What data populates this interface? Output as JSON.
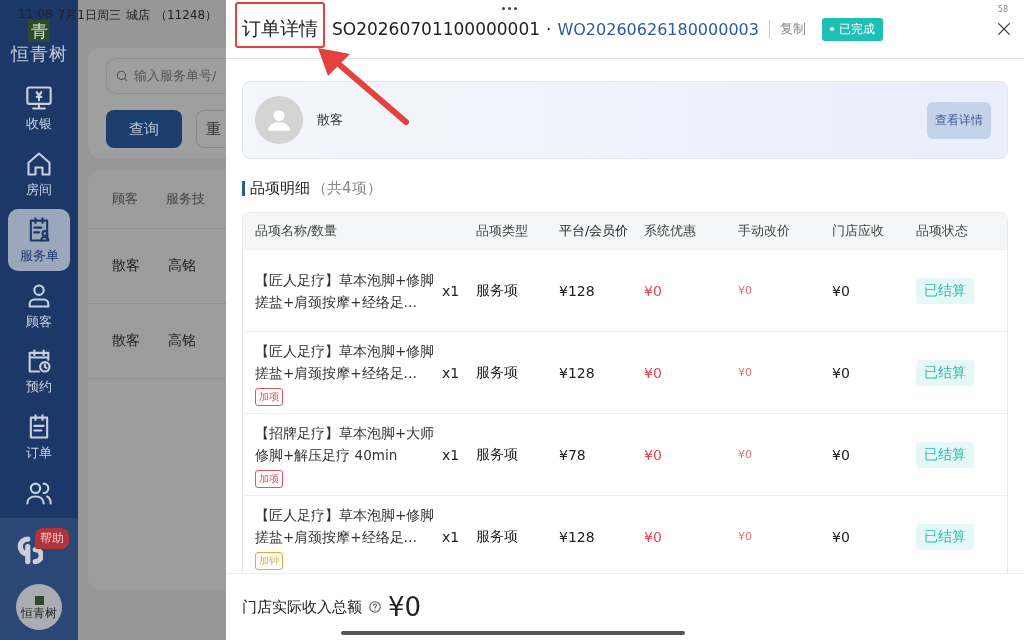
{
  "status_bar": {
    "time": "11:08",
    "date": "7月1日周三",
    "store": "城店",
    "store_code": "（11248）"
  },
  "sidebar": {
    "logo_char": "青",
    "brand": "恒青树",
    "items": [
      {
        "label": "收银",
        "selected": false
      },
      {
        "label": "房间",
        "selected": false
      },
      {
        "label": "服务单",
        "selected": true
      },
      {
        "label": "顾客",
        "selected": false
      },
      {
        "label": "预约",
        "selected": false
      },
      {
        "label": "订单",
        "selected": false
      },
      {
        "selected": false
      }
    ],
    "help_badge": "帮助",
    "footer_logo_char": "恒青树"
  },
  "background": {
    "search": {
      "placeholder": "输入服务单号/"
    },
    "buttons": [
      "查询",
      "重"
    ],
    "columns": [
      "顾客",
      "服务技"
    ],
    "rows": [
      [
        "散客",
        "高铭"
      ],
      [
        "散客",
        "高铭"
      ]
    ]
  },
  "drawer": {
    "title": "订单详情",
    "service_order": "SO20260701100000001",
    "separator": "·",
    "work_order": "WO20260626180000003",
    "copy": "复制",
    "status": "已完成",
    "corner_number": "58",
    "customer": {
      "name": "散客",
      "button": "查看详情"
    },
    "section": {
      "title": "品项明细",
      "count": "（共4项）"
    },
    "table": {
      "columns": [
        "品项名称/数量",
        "品项类型",
        "平台/会员价",
        "系统优惠",
        "手动改价",
        "门店应收",
        "品项状态"
      ],
      "rows": [
        {
          "name": "【匠人足疗】草本泡脚+修脚搓盐+肩颈按摩+经络足…",
          "qty": "x1",
          "type": "服务项",
          "price": "¥128",
          "system_discount": "¥0",
          "manual_price": "¥0",
          "receivable": "¥0",
          "status": "已结算"
        },
        {
          "name": "【匠人足疗】草本泡脚+修脚搓盐+肩颈按摩+经络足…",
          "tag": {
            "text": "加项",
            "color": "#e0555a"
          },
          "qty": "x1",
          "type": "服务项",
          "price": "¥128",
          "system_discount": "¥0",
          "manual_price": "¥0",
          "receivable": "¥0",
          "status": "已结算"
        },
        {
          "name": "【招牌足疗】草本泡脚+大师修脚+解压足疗 40min",
          "tag": {
            "text": "加项",
            "color": "#e0555a"
          },
          "qty": "x1",
          "type": "服务项",
          "price": "¥78",
          "system_discount": "¥0",
          "manual_price": "¥0",
          "receivable": "¥0",
          "status": "已结算"
        },
        {
          "name": "【匠人足疗】草本泡脚+修脚搓盐+肩颈按摩+经络足…",
          "tag": {
            "text": "加钟",
            "color": "#e8a93a"
          },
          "qty": "x1",
          "type": "服务项",
          "price": "¥128",
          "system_discount": "¥0",
          "manual_price": "¥0",
          "receivable": "¥0",
          "status": "已结算"
        }
      ]
    },
    "total": {
      "label": "门店实际收入总额",
      "amount": "¥0"
    }
  }
}
